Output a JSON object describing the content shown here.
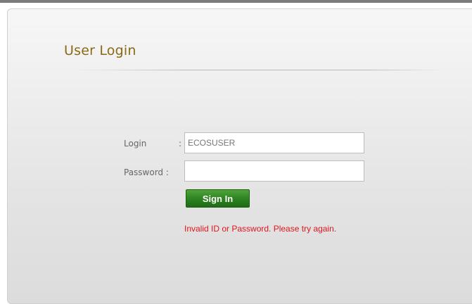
{
  "login_panel": {
    "title": "User Login",
    "login_label": "Login",
    "login_colon": ":",
    "login_value": "ECOSUSER",
    "password_label": "Password :",
    "password_value": "",
    "sign_in_label": "Sign In",
    "error_message": "Invalid ID or Password. Please try again."
  },
  "colors": {
    "title": "#8a6a14",
    "button": "#2f8423",
    "error": "#e0151c",
    "label": "#666666"
  }
}
